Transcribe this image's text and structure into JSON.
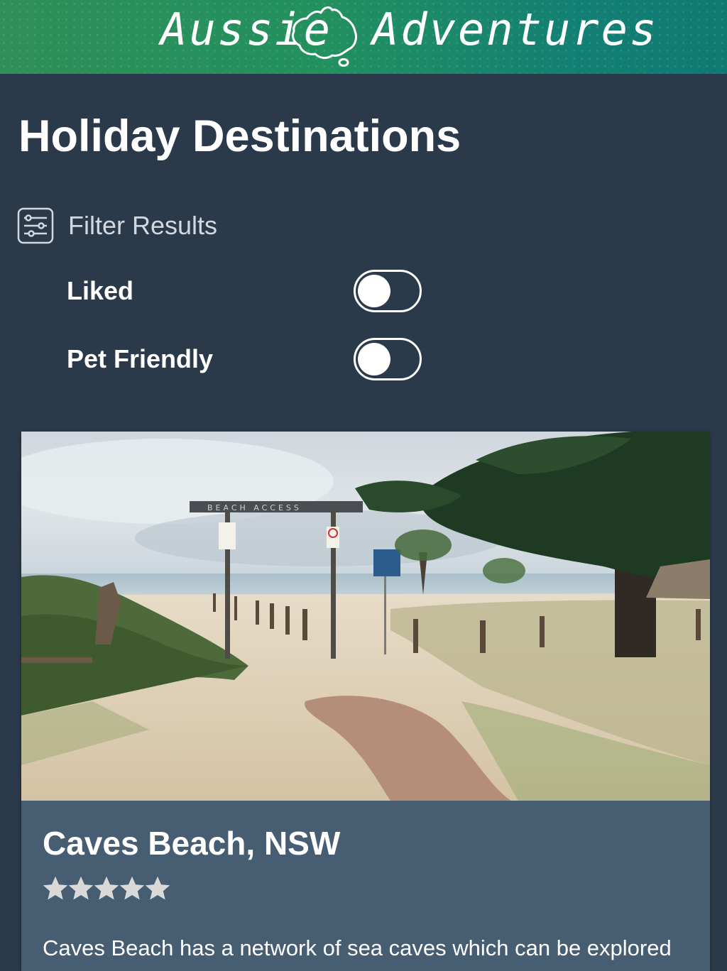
{
  "header": {
    "logo_left": "Aussie",
    "logo_right": "Adventures",
    "logo_icon": "australia-map-icon",
    "gradient_colors": [
      "#2f8f57",
      "#0f7a72"
    ]
  },
  "page": {
    "title": "Holiday Destinations",
    "background": "#2b3a4b"
  },
  "filters": {
    "header_label": "Filter Results",
    "header_icon": "sliders-icon",
    "items": [
      {
        "label": "Liked",
        "on": false
      },
      {
        "label": "Pet Friendly",
        "on": false
      }
    ]
  },
  "destinations": [
    {
      "title": "Caves Beach, NSW",
      "rating": 5,
      "rating_max": 5,
      "star_color": "#d9d9d9",
      "photo_sign_text": "BEACH ACCESS",
      "description": "Caves Beach has a network of sea caves which can be explored"
    }
  ]
}
